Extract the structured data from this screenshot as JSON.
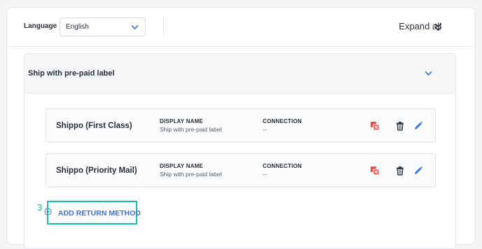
{
  "language": {
    "label": "Language",
    "selected": "English"
  },
  "header": {
    "expand_all": "Expand all"
  },
  "section": {
    "title": "Ship with pre-paid label"
  },
  "methods": [
    {
      "name": "Shippo (First Class)",
      "display_name_label": "DISPLAY NAME",
      "display_name": "Ship with pre-paid label",
      "connection_label": "CONNECTION",
      "connection": "--"
    },
    {
      "name": "Shippo (Priority Mail)",
      "display_name_label": "DISPLAY NAME",
      "display_name": "Ship with pre-paid label",
      "connection_label": "CONNECTION",
      "connection": "--"
    }
  ],
  "add_method": {
    "step": "3",
    "label": "ADD RETURN METHOD"
  },
  "colors": {
    "accent_blue": "#3f6fd1",
    "highlight_teal": "#24b7a3",
    "danger_red": "#e5534b"
  },
  "icons": {
    "language_dropdown": "chevron-down-icon",
    "expand_all": "double-chevron-down-icon",
    "section_toggle": "chevron-down-icon",
    "row_actions": [
      "disconnect-icon",
      "trash-icon",
      "pencil-icon"
    ],
    "add": "plus-circle-icon"
  }
}
